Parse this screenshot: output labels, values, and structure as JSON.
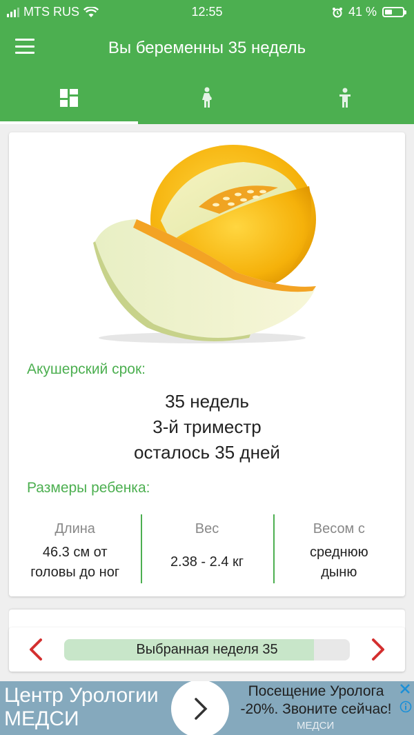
{
  "status": {
    "carrier": "MTS RUS",
    "time": "12:55",
    "battery": "41 %"
  },
  "header": {
    "title": "Вы беременны 35 недель"
  },
  "tabs": [
    {
      "name": "dashboard",
      "icon": "dashboard-icon",
      "active": true
    },
    {
      "name": "mother",
      "icon": "pregnant-woman-icon",
      "active": false
    },
    {
      "name": "baby",
      "icon": "child-icon",
      "active": false
    }
  ],
  "card": {
    "image": "melon-icon",
    "term_label": "Акушерский срок:",
    "term_lines": [
      "35 недель",
      "3-й триместр",
      "осталось 35 дней"
    ],
    "size_label": "Размеры ребенка:",
    "stats": [
      {
        "head": "Длина",
        "lines": [
          "46.3 см от",
          "головы до ног"
        ]
      },
      {
        "head": "Вес",
        "lines": [
          "2.38 - 2.4 кг"
        ]
      },
      {
        "head": "Весом с",
        "lines": [
          "среднюю",
          "дыню"
        ]
      }
    ]
  },
  "week_selector": {
    "label": "Выбранная неделя 35",
    "progress": 0.875
  },
  "ad": {
    "title_lines": [
      "Центр Урологии",
      "МЕДСИ"
    ],
    "text_lines": [
      "Посещение Уролога",
      "-20%. Звоните сейчас!"
    ],
    "brand": "МЕДСИ"
  },
  "colors": {
    "accent": "#4caf50",
    "arrow": "#d32f2f",
    "ad_bg": "#85a9bd"
  }
}
